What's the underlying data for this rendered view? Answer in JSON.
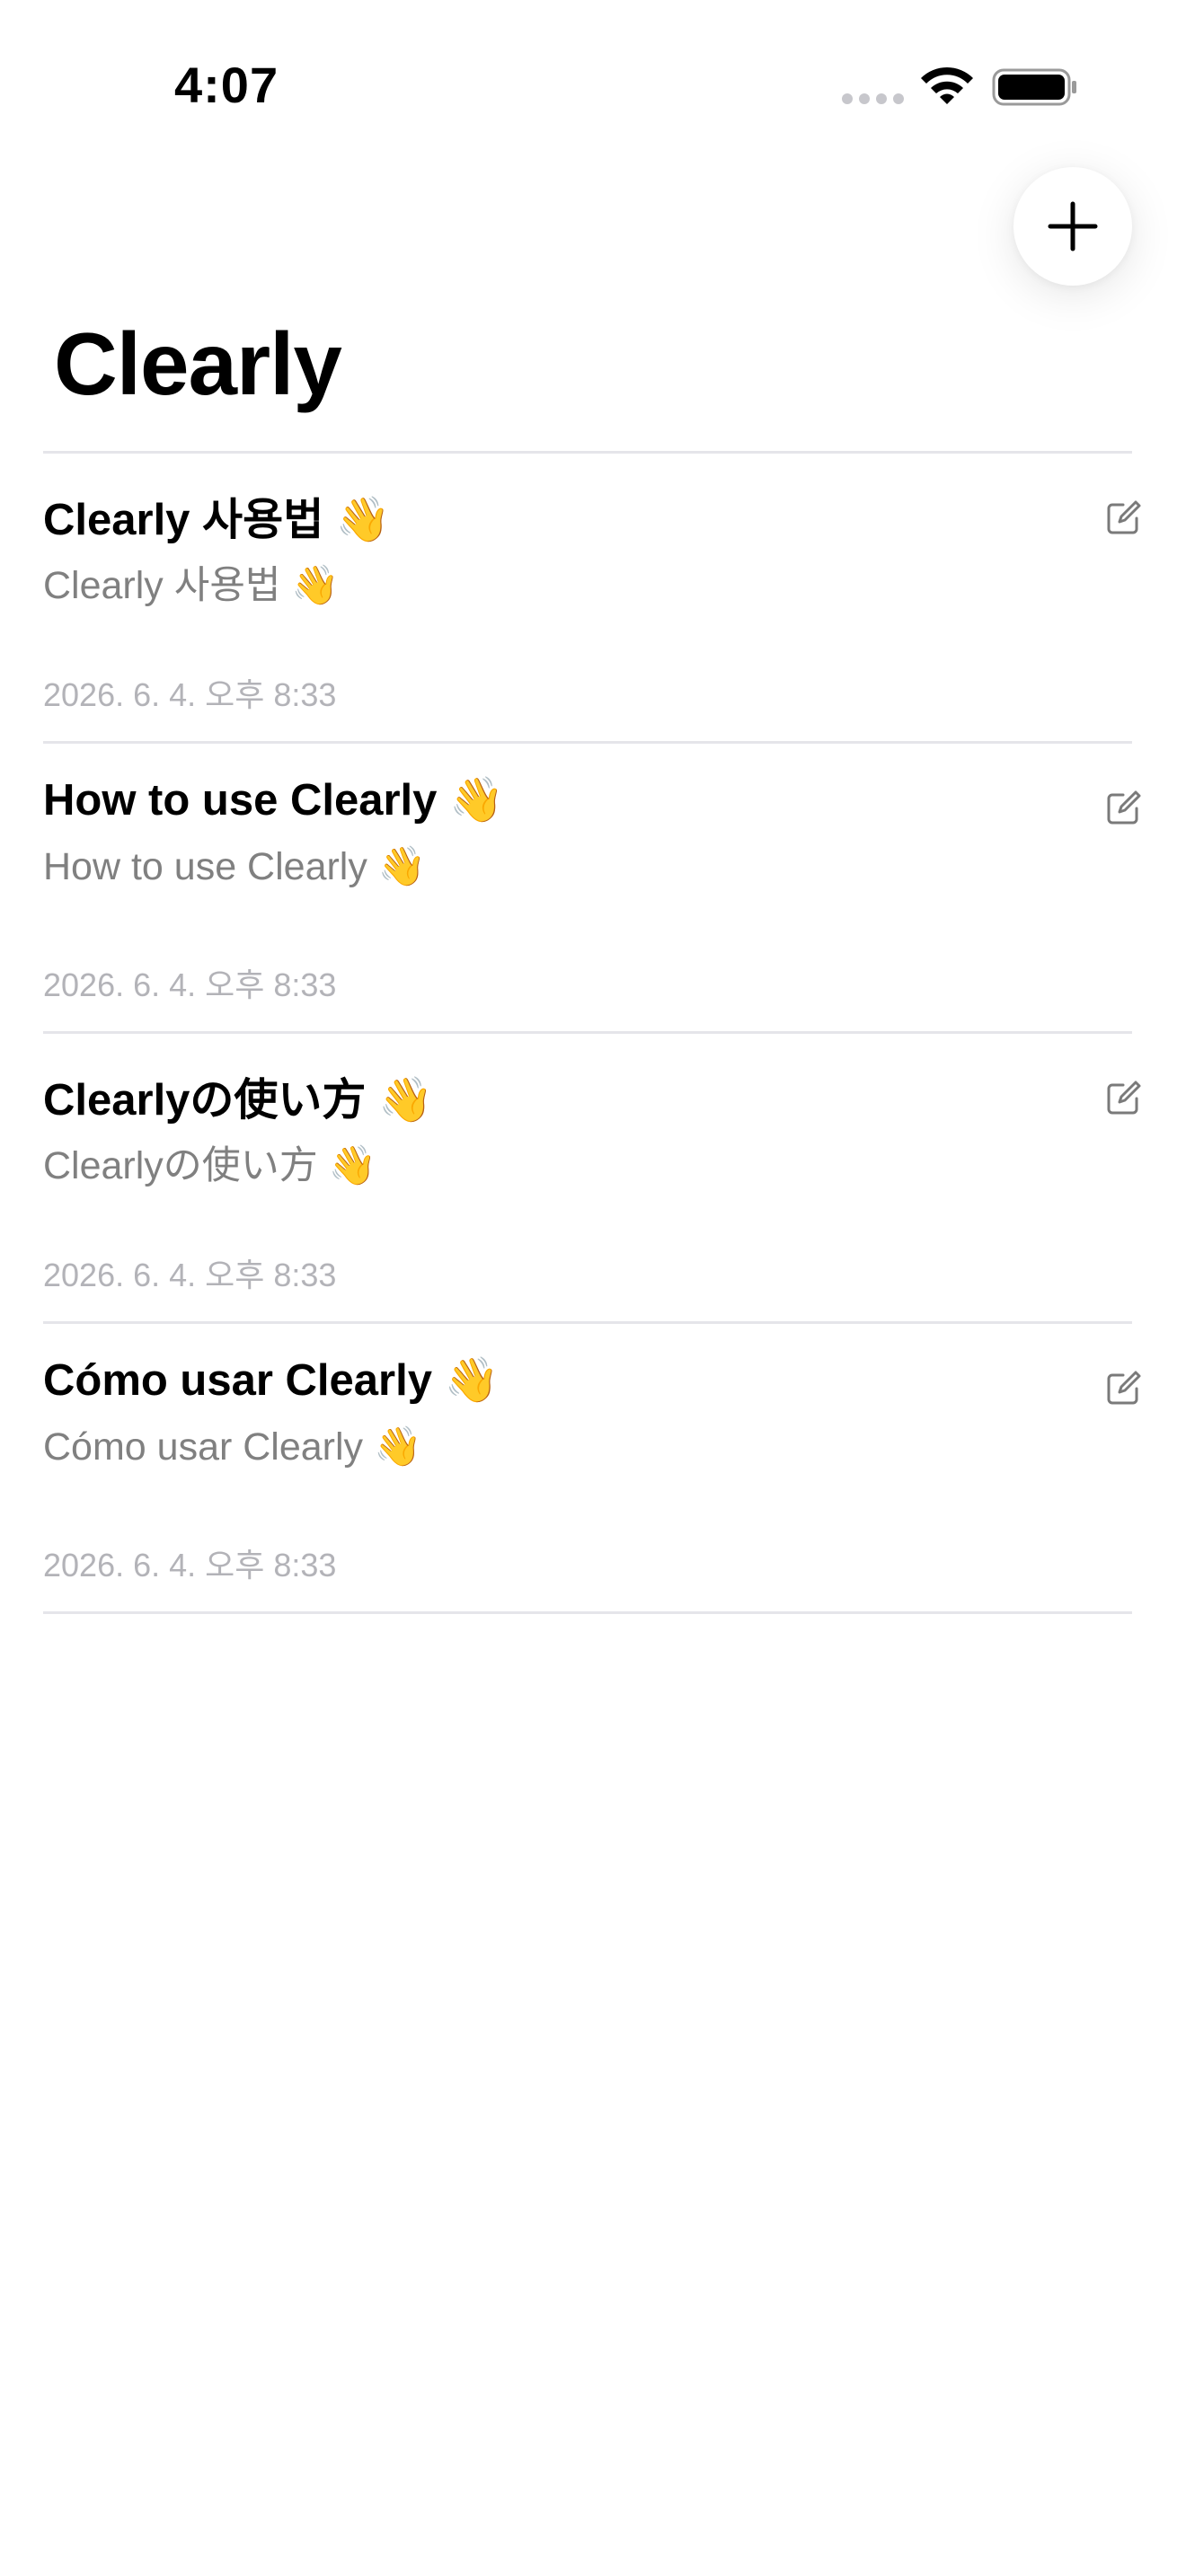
{
  "status_bar": {
    "time": "4:07",
    "signal_icon": "cellular-dots-icon",
    "wifi_icon": "wifi-icon",
    "battery_icon": "battery-full-icon"
  },
  "header": {
    "title": "Clearly",
    "add_icon": "plus-icon"
  },
  "notes": [
    {
      "title": "Clearly 사용법 👋",
      "preview": "Clearly 사용법 👋",
      "date": "2026. 6. 4. 오후 8:33",
      "action_icon": "edit-icon"
    },
    {
      "title": "How to use Clearly 👋",
      "preview": "How to use Clearly 👋",
      "date": "2026. 6. 4. 오후 8:33",
      "action_icon": "edit-icon"
    },
    {
      "title": "Clearlyの使い方 👋",
      "preview": "Clearlyの使い方 👋",
      "date": "2026. 6. 4. 오후 8:33",
      "action_icon": "edit-icon"
    },
    {
      "title": "Cómo usar Clearly 👋",
      "preview": "Cómo usar Clearly 👋",
      "date": "2026. 6. 4. 오후 8:33",
      "action_icon": "edit-icon"
    }
  ],
  "colors": {
    "background": "#ffffff",
    "title_text": "#000000",
    "preview_text": "#808080",
    "date_text": "#b3b3b8",
    "divider": "#e5e5ea"
  }
}
